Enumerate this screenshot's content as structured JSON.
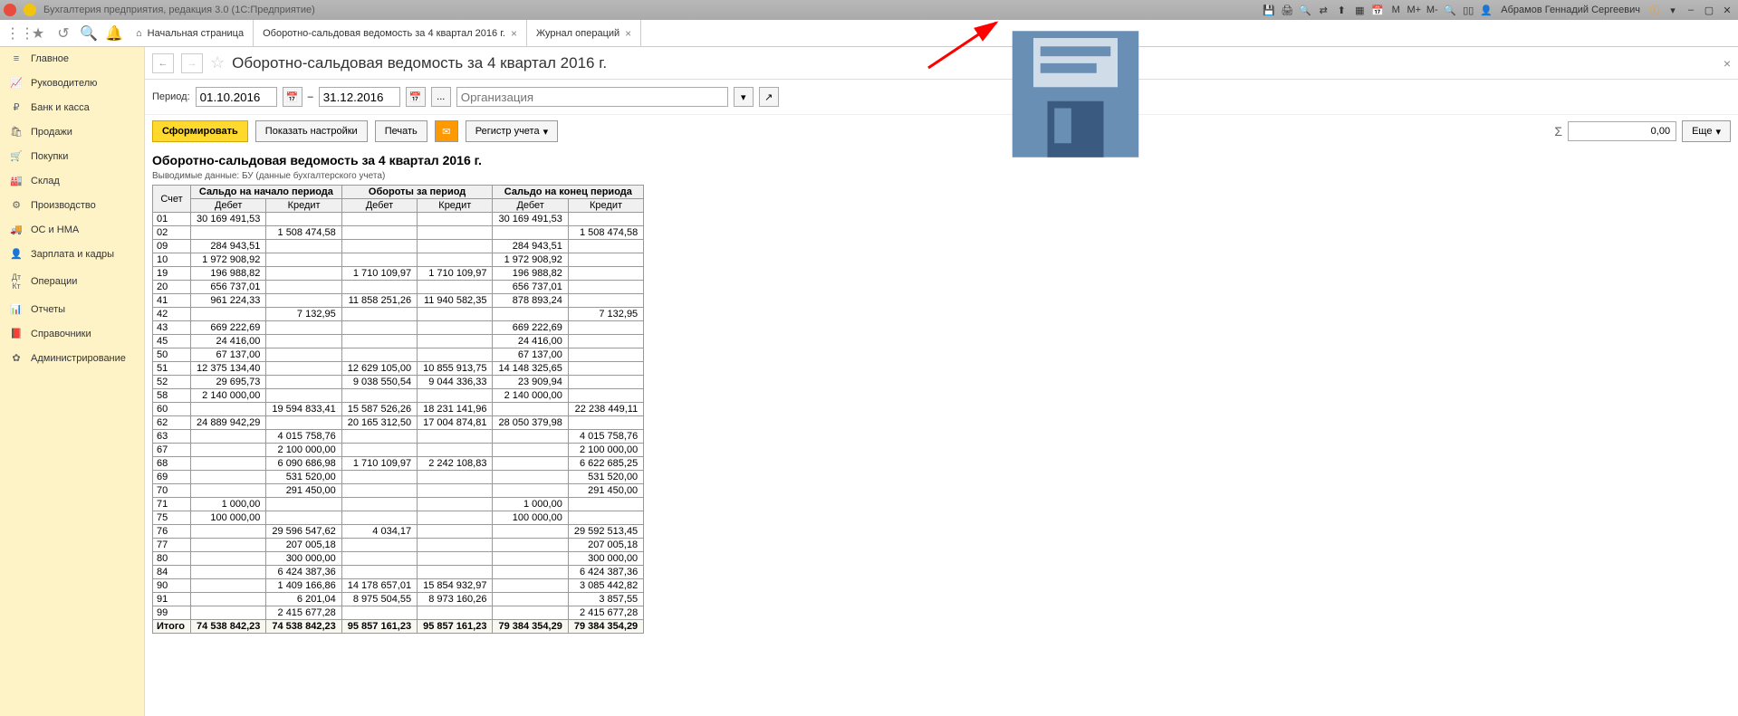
{
  "app_title": "Бухгалтерия предприятия, редакция 3.0  (1С:Предприятие)",
  "user": "Абрамов Геннадий Сергеевич",
  "tabs": {
    "home": "Начальная страница",
    "t1": "Оборотно-сальдовая ведомость за 4 квартал 2016 г.",
    "t2": "Журнал операций"
  },
  "sidebar": [
    "Главное",
    "Руководителю",
    "Банк и касса",
    "Продажи",
    "Покупки",
    "Склад",
    "Производство",
    "ОС и НМА",
    "Зарплата и кадры",
    "Операции",
    "Отчеты",
    "Справочники",
    "Администрирование"
  ],
  "page_title": "Оборотно-сальдовая ведомость за 4 квартал 2016 г.",
  "period_label": "Период:",
  "date_from": "01.10.2016",
  "date_to": "31.12.2016",
  "dash": "–",
  "org_placeholder": "Организация",
  "ellipsis": "...",
  "btn_form": "Сформировать",
  "btn_settings": "Показать настройки",
  "btn_print": "Печать",
  "btn_register": "Регистр учета",
  "btn_more": "Еще",
  "sum_value": "0,00",
  "sigma": "Σ",
  "report": {
    "title": "Оборотно-сальдовая ведомость за 4 квартал 2016 г.",
    "subtitle": "Выводимые данные:  БУ (данные бухгалтерского учета)",
    "col_account": "Счет",
    "grp_start": "Сальдо на начало периода",
    "grp_turn": "Обороты за период",
    "grp_end": "Сальдо на конец периода",
    "col_debit": "Дебет",
    "col_credit": "Кредит",
    "total_label": "Итого"
  },
  "chart_data": {
    "type": "table",
    "columns": [
      "Счет",
      "Сальдо нач Дебет",
      "Сальдо нач Кредит",
      "Обороты Дебет",
      "Обороты Кредит",
      "Сальдо кон Дебет",
      "Сальдо кон Кредит"
    ],
    "rows": [
      [
        "01",
        "30 169 491,53",
        "",
        "",
        "",
        "30 169 491,53",
        ""
      ],
      [
        "02",
        "",
        "1 508 474,58",
        "",
        "",
        "",
        "1 508 474,58"
      ],
      [
        "09",
        "284 943,51",
        "",
        "",
        "",
        "284 943,51",
        ""
      ],
      [
        "10",
        "1 972 908,92",
        "",
        "",
        "",
        "1 972 908,92",
        ""
      ],
      [
        "19",
        "196 988,82",
        "",
        "1 710 109,97",
        "1 710 109,97",
        "196 988,82",
        ""
      ],
      [
        "20",
        "656 737,01",
        "",
        "",
        "",
        "656 737,01",
        ""
      ],
      [
        "41",
        "961 224,33",
        "",
        "11 858 251,26",
        "11 940 582,35",
        "878 893,24",
        ""
      ],
      [
        "42",
        "",
        "7 132,95",
        "",
        "",
        "",
        "7 132,95"
      ],
      [
        "43",
        "669 222,69",
        "",
        "",
        "",
        "669 222,69",
        ""
      ],
      [
        "45",
        "24 416,00",
        "",
        "",
        "",
        "24 416,00",
        ""
      ],
      [
        "50",
        "67 137,00",
        "",
        "",
        "",
        "67 137,00",
        ""
      ],
      [
        "51",
        "12 375 134,40",
        "",
        "12 629 105,00",
        "10 855 913,75",
        "14 148 325,65",
        ""
      ],
      [
        "52",
        "29 695,73",
        "",
        "9 038 550,54",
        "9 044 336,33",
        "23 909,94",
        ""
      ],
      [
        "58",
        "2 140 000,00",
        "",
        "",
        "",
        "2 140 000,00",
        ""
      ],
      [
        "60",
        "",
        "19 594 833,41",
        "15 587 526,26",
        "18 231 141,96",
        "",
        "22 238 449,11"
      ],
      [
        "62",
        "24 889 942,29",
        "",
        "20 165 312,50",
        "17 004 874,81",
        "28 050 379,98",
        ""
      ],
      [
        "63",
        "",
        "4 015 758,76",
        "",
        "",
        "",
        "4 015 758,76"
      ],
      [
        "67",
        "",
        "2 100 000,00",
        "",
        "",
        "",
        "2 100 000,00"
      ],
      [
        "68",
        "",
        "6 090 686,98",
        "1 710 109,97",
        "2 242 108,83",
        "",
        "6 622 685,25"
      ],
      [
        "69",
        "",
        "531 520,00",
        "",
        "",
        "",
        "531 520,00"
      ],
      [
        "70",
        "",
        "291 450,00",
        "",
        "",
        "",
        "291 450,00"
      ],
      [
        "71",
        "1 000,00",
        "",
        "",
        "",
        "1 000,00",
        ""
      ],
      [
        "75",
        "100 000,00",
        "",
        "",
        "",
        "100 000,00",
        ""
      ],
      [
        "76",
        "",
        "29 596 547,62",
        "4 034,17",
        "",
        "",
        "29 592 513,45"
      ],
      [
        "77",
        "",
        "207 005,18",
        "",
        "",
        "",
        "207 005,18"
      ],
      [
        "80",
        "",
        "300 000,00",
        "",
        "",
        "",
        "300 000,00"
      ],
      [
        "84",
        "",
        "6 424 387,36",
        "",
        "",
        "",
        "6 424 387,36"
      ],
      [
        "90",
        "",
        "1 409 166,86",
        "14 178 657,01",
        "15 854 932,97",
        "",
        "3 085 442,82"
      ],
      [
        "91",
        "",
        "6 201,04",
        "8 975 504,55",
        "8 973 160,26",
        "",
        "3 857,55"
      ],
      [
        "99",
        "",
        "2 415 677,28",
        "",
        "",
        "",
        "2 415 677,28"
      ]
    ],
    "totals": [
      "Итого",
      "74 538 842,23",
      "74 538 842,23",
      "95 857 161,23",
      "95 857 161,23",
      "79 384 354,29",
      "79 384 354,29"
    ]
  }
}
